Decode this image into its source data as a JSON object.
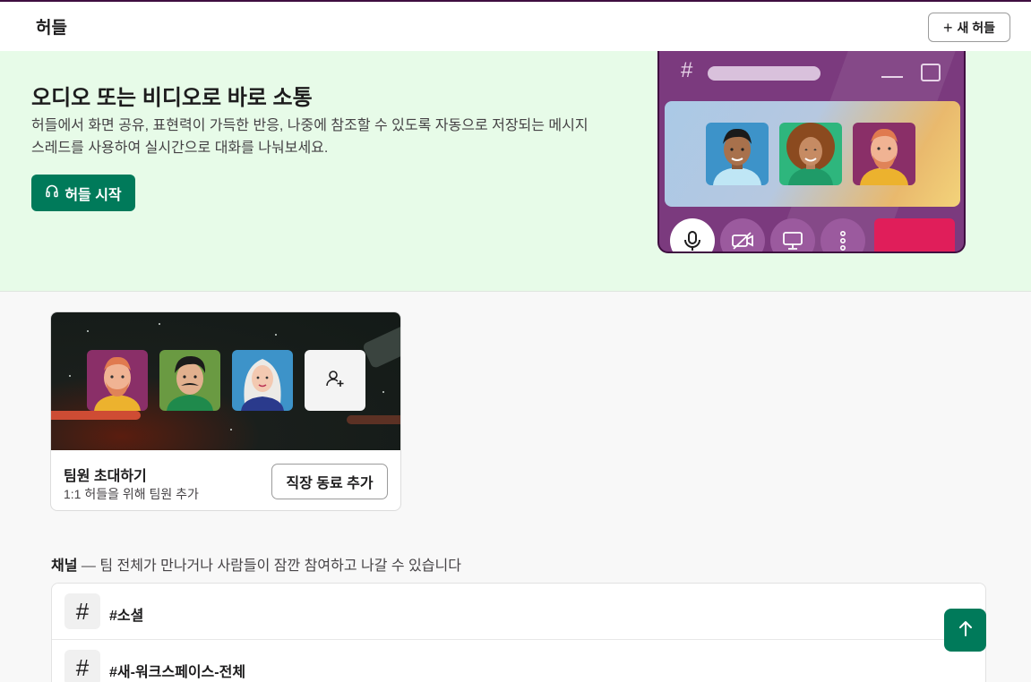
{
  "header": {
    "title": "허들",
    "new_button": "새 허들"
  },
  "hero": {
    "title": "오디오 또는 비디오로 바로 소통",
    "description": "허들에서 화면 공유, 표현력이 가득한 반응, 나중에 참조할 수 있도록 자동으로 저장되는 메시지 스레드를 사용하여 실시간으로 대화를 나눠보세요.",
    "start_button": "허들 시작",
    "illustration": {
      "hash": "#"
    }
  },
  "invite": {
    "title": "팀원 초대하기",
    "subtitle": "1:1 허들을 위해 팀원 추가",
    "button": "직장 동료 추가"
  },
  "channels": {
    "label": "채널",
    "description": "— 팀 전체가 만나거나 사람들이 잠깐 참여하고 나갈 수 있습니다",
    "items": [
      {
        "name": "#소셜"
      },
      {
        "name": "#새-워크스페이스-전체"
      }
    ]
  },
  "colors": {
    "accent": "#007a5a",
    "hero_bg": "#e7fbe8",
    "aubergine": "#3f0e40",
    "danger": "#e01e5a"
  },
  "icons": [
    "plus-icon",
    "headphones-icon",
    "microphone-icon",
    "camera-off-icon",
    "screen-share-icon",
    "more-icon",
    "add-user-icon",
    "hash-icon",
    "arrow-up-icon"
  ]
}
